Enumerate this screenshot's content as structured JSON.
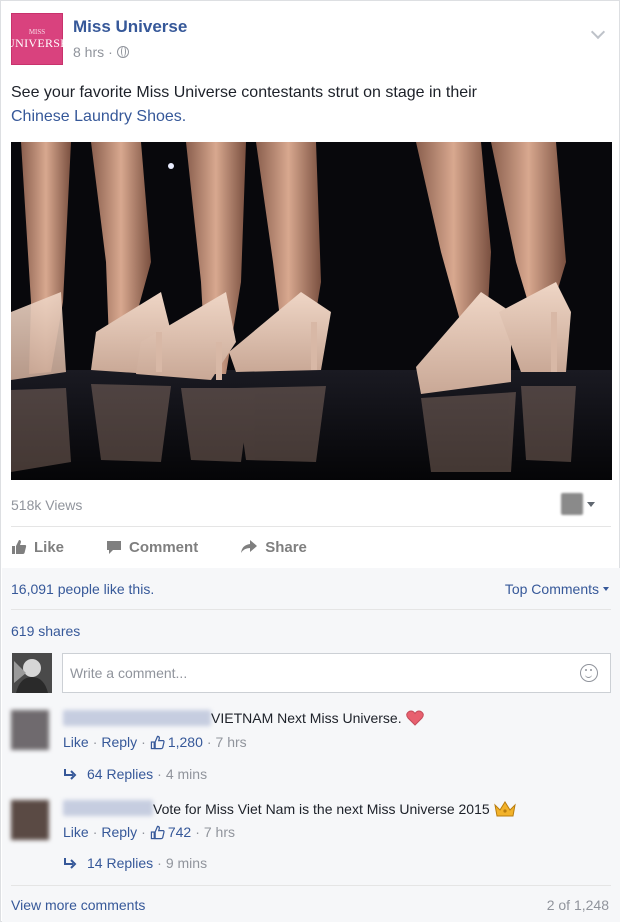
{
  "post": {
    "page_name": "Miss Universe",
    "logo_text_top": "MISS",
    "logo_text": "UNIVERSE",
    "time": "8 hrs",
    "meta_dot": "·",
    "text": "See your favorite Miss Universe contestants strut on stage in their",
    "link_text": "Chinese Laundry Shoes."
  },
  "video": {
    "views": "518k Views"
  },
  "actions": {
    "like": "Like",
    "comment": "Comment",
    "share": "Share"
  },
  "stats": {
    "likes": "16,091 people like this.",
    "sort": "Top Comments",
    "shares": "619 shares"
  },
  "composer": {
    "placeholder": "Write a comment..."
  },
  "comments": [
    {
      "text": "VIETNAM Next Miss Universe.",
      "emoji": "heart-icon",
      "like": "Like",
      "reply": "Reply",
      "likes_count": "1,280",
      "time": "7 hrs",
      "replies": "64 Replies",
      "replies_time": "4 mins"
    },
    {
      "text": "Vote for Miss Viet Nam is the next Miss Universe 2015",
      "emoji": "crown-icon",
      "like": "Like",
      "reply": "Reply",
      "likes_count": "742",
      "time": "7 hrs",
      "replies": "14 Replies",
      "replies_time": "9 mins"
    }
  ],
  "footer": {
    "view_more": "View more comments",
    "pager": "2 of 1,248"
  },
  "colors": {
    "link": "#365899",
    "muted": "#90949c",
    "logo": "#d9427e",
    "heart": "#e8606f",
    "crown": "#f2b22a"
  }
}
